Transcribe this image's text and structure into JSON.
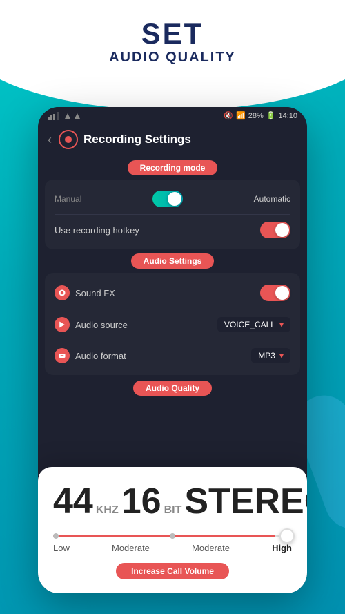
{
  "header": {
    "set_label": "SET",
    "subtitle": "AUDIO QUALITY"
  },
  "status_bar": {
    "battery": "28%",
    "time": "14:10"
  },
  "app_header": {
    "title": "Recording Settings",
    "back": "‹"
  },
  "recording_mode_badge": "Recording mode",
  "recording_mode": {
    "manual_label": "Manual",
    "automatic_label": "Automatic",
    "hotkey_label": "Use recording hotkey"
  },
  "audio_settings_badge": "Audio Settings",
  "audio_settings": {
    "sound_fx_label": "Sound FX",
    "audio_source_label": "Audio source",
    "audio_source_value": "VOICE_CALL",
    "audio_format_label": "Audio format",
    "audio_format_value": "MP3"
  },
  "audio_quality_badge": "Audio Quality",
  "audio_quality": {
    "freq": "44",
    "freq_unit": "KHZ",
    "bits": "16",
    "bits_unit": "BIT",
    "mode": "STEREO",
    "slider_labels": [
      "Low",
      "Moderate",
      "Moderate",
      "High"
    ],
    "slider_value": 93
  },
  "increase_call_volume_btn": "Increase Call Volume"
}
